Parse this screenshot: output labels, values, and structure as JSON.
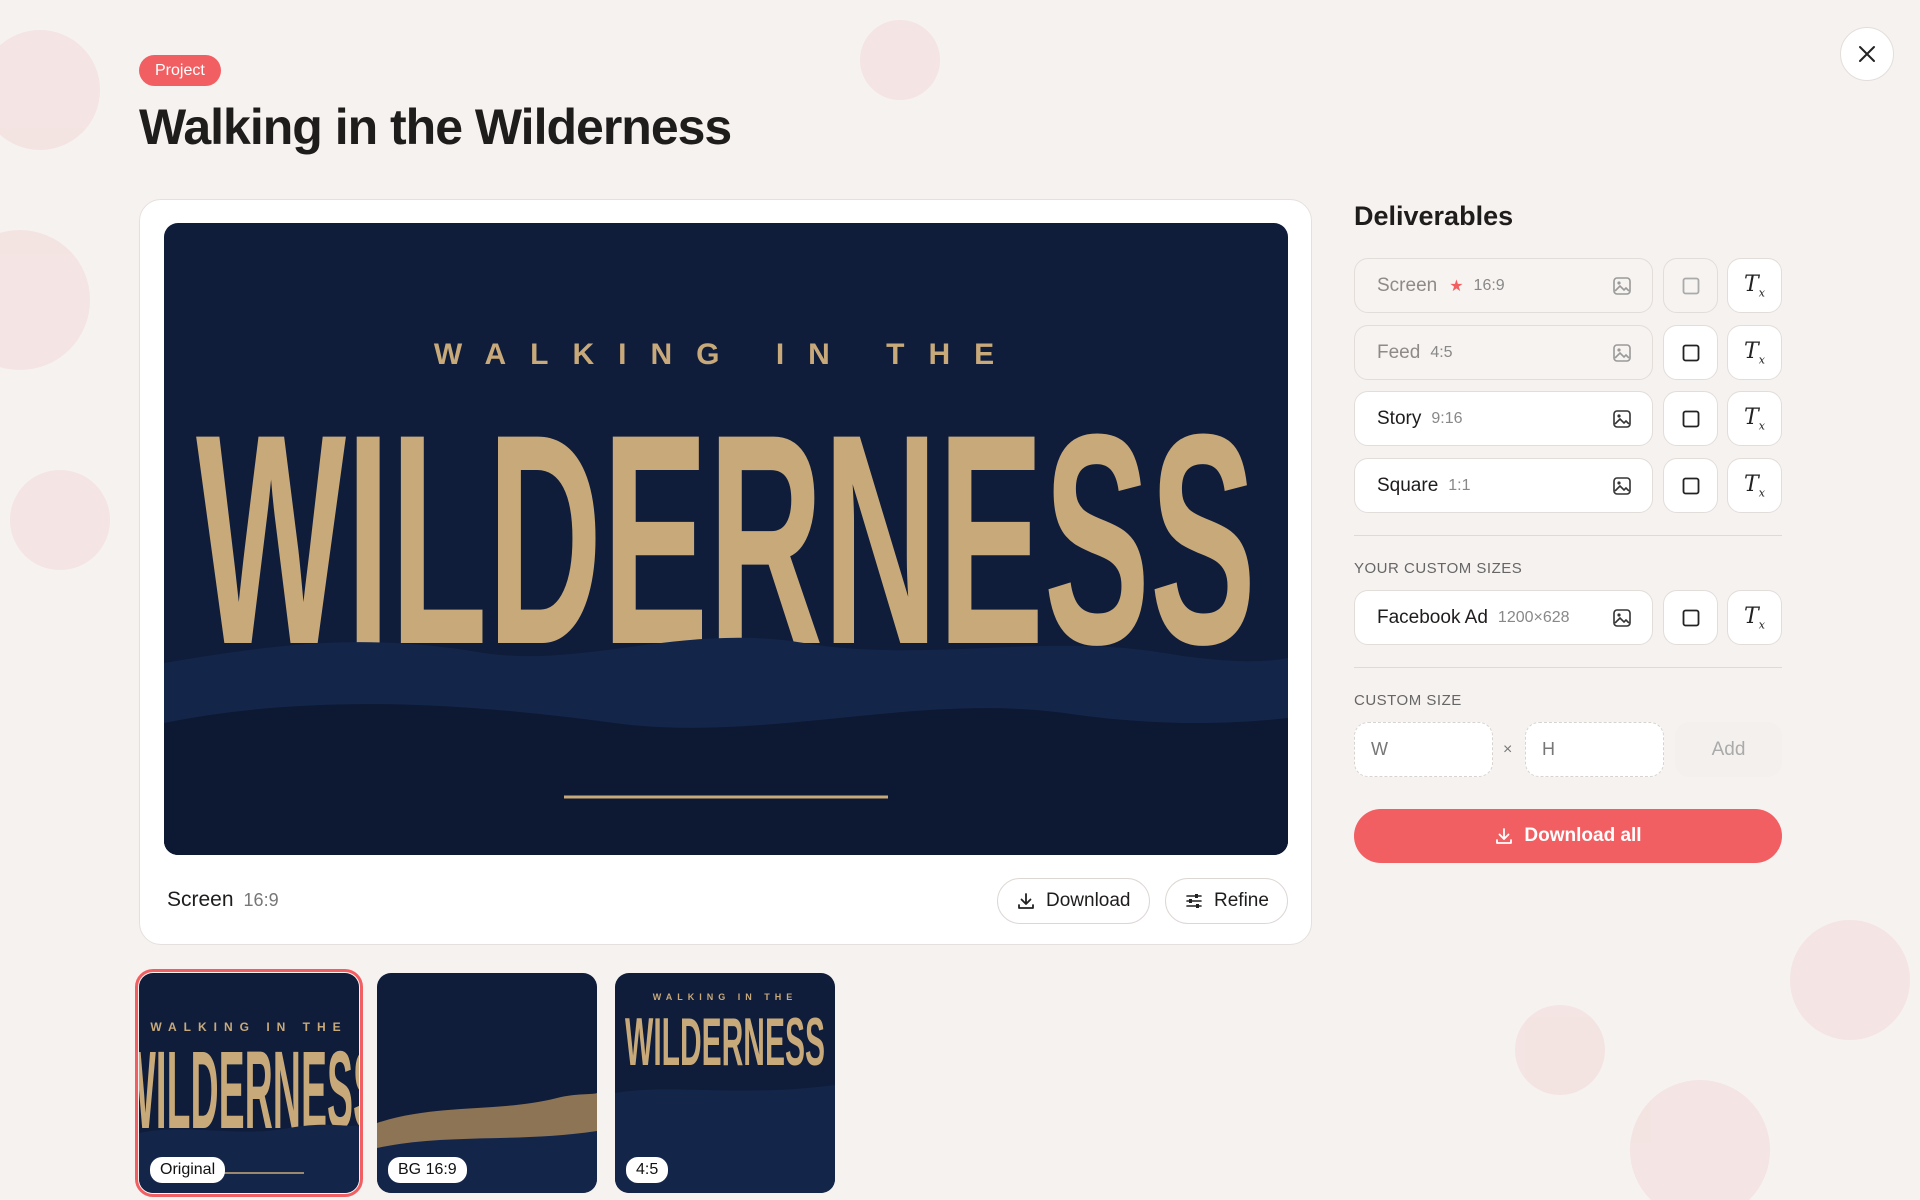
{
  "header": {
    "badge": "Project",
    "title": "Walking in the Wilderness"
  },
  "artwork": {
    "line1": "WALKING IN THE",
    "line2": "WILDERNESS"
  },
  "preview": {
    "label": "Screen",
    "ratio": "16:9",
    "download_label": "Download",
    "refine_label": "Refine"
  },
  "thumbnails": [
    {
      "label": "Original",
      "selected": true
    },
    {
      "label": "BG 16:9",
      "selected": false
    },
    {
      "label": "4:5",
      "selected": false
    }
  ],
  "deliverables": {
    "title": "Deliverables",
    "items": [
      {
        "label": "Screen",
        "ratio": "16:9",
        "starred": true
      },
      {
        "label": "Feed",
        "ratio": "4:5"
      },
      {
        "label": "Story",
        "ratio": "9:16"
      },
      {
        "label": "Square",
        "ratio": "1:1"
      }
    ],
    "custom_sizes_heading": "YOUR CUSTOM SIZES",
    "custom_items": [
      {
        "label": "Facebook Ad",
        "ratio": "1200×628"
      }
    ],
    "custom_size_heading": "CUSTOM SIZE",
    "width_placeholder": "W",
    "height_placeholder": "H",
    "times": "×",
    "add_label": "Add",
    "download_all_label": "Download all"
  },
  "colors": {
    "accent": "#f25f62",
    "art_background": "#0f1d3b",
    "art_sand": "#c8a97a"
  }
}
